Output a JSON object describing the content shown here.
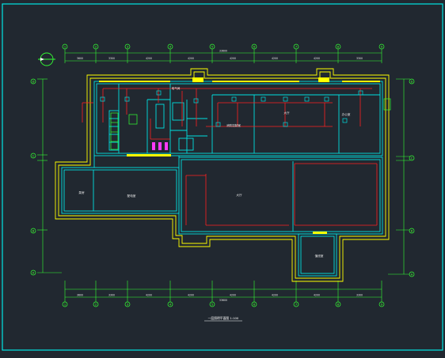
{
  "drawing": {
    "grid_x": [
      "1",
      "2",
      "3",
      "4",
      "5",
      "6",
      "7",
      "8",
      "9"
    ],
    "grid_y": [
      "D",
      "C",
      "B",
      "A"
    ],
    "dims_top": [
      "3600",
      "3300",
      "4200",
      "4200",
      "4200",
      "4200",
      "4200",
      "3300"
    ],
    "dims_overall": "33600",
    "rooms": {
      "r1": "电气间",
      "r2": "消防控制室",
      "r3": "大厅",
      "r4": "办公室",
      "r5": "大厅",
      "r6": "泵房",
      "r7": "配电室",
      "r8": "值班室"
    },
    "title": "一层照明平面图 1:100"
  },
  "colors": {
    "background": "#212830",
    "frame": "#00e5e5",
    "wall": "#00e0e0",
    "outline": "#ffff00",
    "dimension": "#33ff33",
    "wiring": "#ff2020",
    "fixture": "#ff3aff"
  }
}
